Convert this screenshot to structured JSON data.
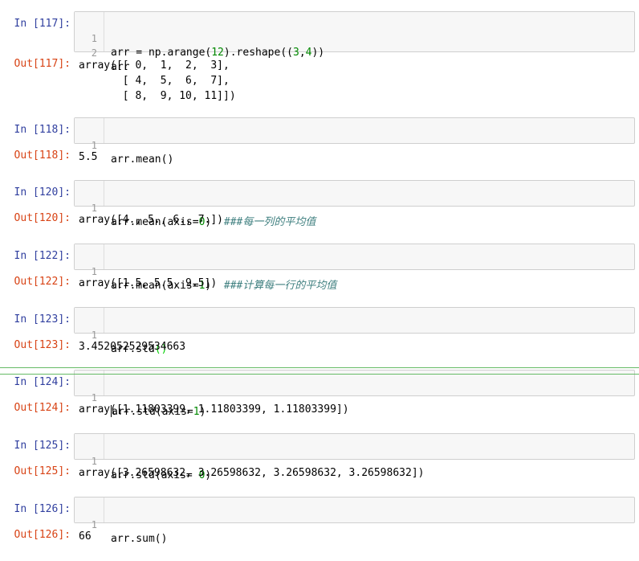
{
  "cells": [
    {
      "in_prompt": "In [117]:",
      "out_prompt": "Out[117]:",
      "lines": [
        {
          "n": "1",
          "code": "arr = np.arange(12).reshape((3,4))"
        },
        {
          "n": "2",
          "code": "arr"
        }
      ],
      "output": "array([[ 0,  1,  2,  3],\n       [ 4,  5,  6,  7],\n       [ 8,  9, 10, 11]])"
    },
    {
      "in_prompt": "In [118]:",
      "out_prompt": "Out[118]:",
      "lines": [
        {
          "n": "1",
          "code": "arr.mean()"
        }
      ],
      "output": "5.5"
    },
    {
      "in_prompt": "In [120]:",
      "out_prompt": "Out[120]:",
      "lines": [
        {
          "n": "1",
          "code": "arr.mean(axis=0)",
          "comment": "###每一列的平均值"
        }
      ],
      "output": "array([4., 5., 6., 7.])"
    },
    {
      "in_prompt": "In [122]:",
      "out_prompt": "Out[122]:",
      "lines": [
        {
          "n": "1",
          "code": "arr.mean(axis=1)",
          "comment": "###计算每一行的平均值"
        }
      ],
      "output": "array([1.5, 5.5, 9.5])"
    },
    {
      "in_prompt": "In [123]:",
      "out_prompt": "Out[123]:",
      "lines": [
        {
          "n": "1",
          "code": "arr.std()"
        }
      ],
      "output": "3.452052529534663"
    },
    {
      "in_prompt": "In [124]:",
      "out_prompt": "Out[124]:",
      "lines": [
        {
          "n": "1",
          "code": "arr.std(axis=1)"
        }
      ],
      "output": "array([1.11803399, 1.11803399, 1.11803399])"
    },
    {
      "in_prompt": "In [125]:",
      "out_prompt": "Out[125]:",
      "lines": [
        {
          "n": "1",
          "code": "arr.std(axis= 0)"
        }
      ],
      "output": "array([3.26598632, 3.26598632, 3.26598632, 3.26598632])"
    },
    {
      "in_prompt": "In [126]:",
      "out_prompt": "Out[126]:",
      "lines": [
        {
          "n": "1",
          "code": "arr.sum()"
        }
      ],
      "output": "66"
    }
  ]
}
